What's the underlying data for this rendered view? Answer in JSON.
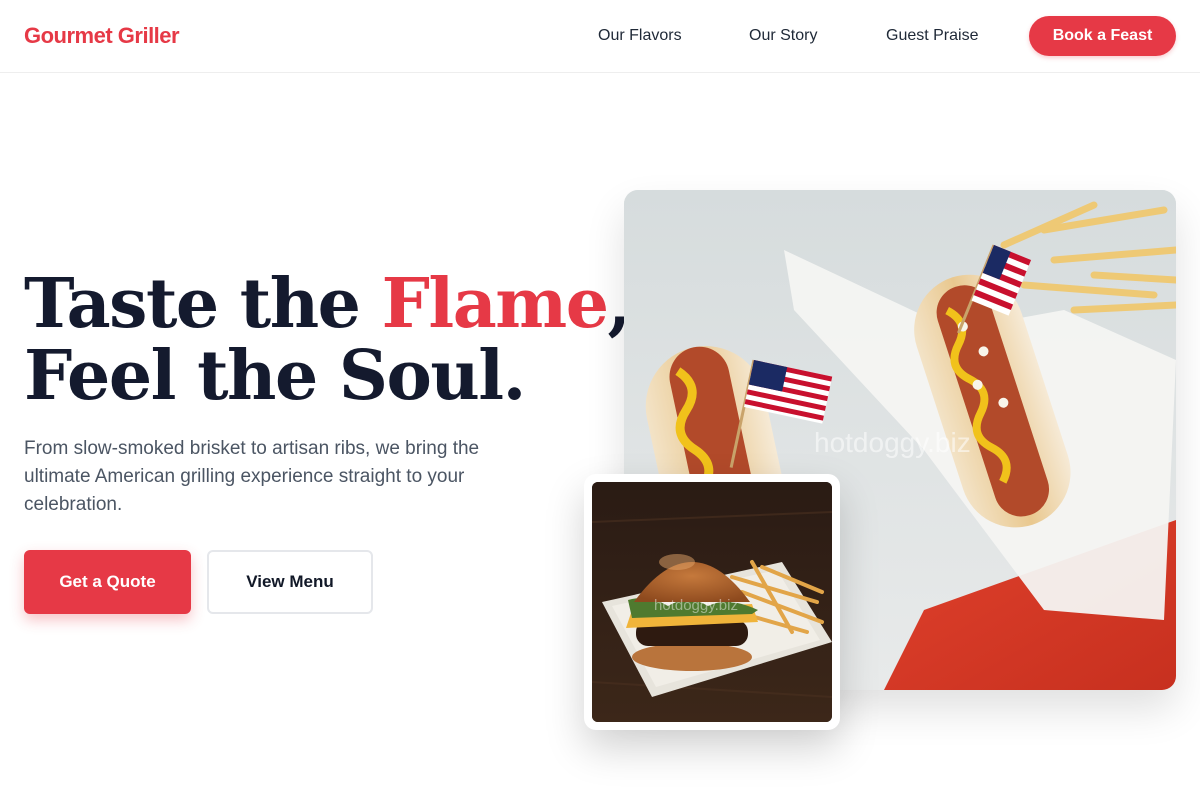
{
  "header": {
    "brand": "Gourmet Griller",
    "nav": [
      "Our Flavors",
      "Our Story",
      "Guest Praise"
    ],
    "cta": "Book a Feast"
  },
  "hero": {
    "headline_line1_pre": "Taste the ",
    "headline_accent": "Flame",
    "headline_line1_post": ",",
    "headline_line2": "Feel the Soul.",
    "subcopy": "From slow-smoked brisket to artisan ribs, we bring the ultimate American grilling experience straight to your celebration.",
    "primary_button": "Get a Quote",
    "secondary_button": "View Menu"
  },
  "images": {
    "main_watermark": "hotdoggy.biz",
    "inset_watermark": "hotdoggy.biz",
    "main_alt": "hot-dogs-with-flags-photo",
    "inset_alt": "burger-with-fries-photo"
  },
  "colors": {
    "brand": "#e63946",
    "headline": "#141a2e",
    "body_text": "#4b5563"
  }
}
